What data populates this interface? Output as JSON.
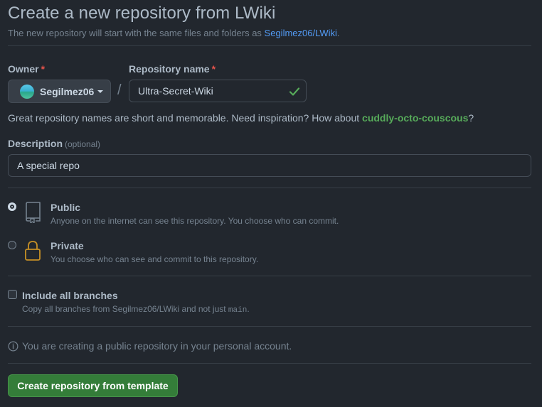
{
  "header": {
    "title": "Create a new repository from LWiki",
    "subtitle_prefix": "The new repository will start with the same files and folders as ",
    "template_link": "Segilmez06/LWiki",
    "subtitle_suffix": "."
  },
  "owner": {
    "label": "Owner",
    "required_mark": "*",
    "selected": "Segilmez06"
  },
  "repo_name": {
    "label": "Repository name",
    "required_mark": "*",
    "separator": "/",
    "value": "Ultra-Secret-Wiki",
    "valid_icon": "check-icon"
  },
  "name_hint": {
    "prefix": "Great repository names are short and memorable. Need inspiration? How about ",
    "suggestion": "cuddly-octo-couscous",
    "suffix": "?"
  },
  "description": {
    "label": "Description",
    "optional": "(optional)",
    "value": "A special repo"
  },
  "visibility": {
    "selected": "Public",
    "options": [
      {
        "title": "Public",
        "desc": "Anyone on the internet can see this repository. You choose who can commit.",
        "icon": "repo-book-icon",
        "checked": true
      },
      {
        "title": "Private",
        "desc": "You choose who can see and commit to this repository.",
        "icon": "lock-icon",
        "checked": false
      }
    ]
  },
  "branches": {
    "label": "Include all branches",
    "desc_prefix": "Copy all branches from Segilmez06/LWiki and not just ",
    "desc_code": "main",
    "desc_suffix": ".",
    "checked": false
  },
  "info": {
    "icon": "info-icon",
    "text": "You are creating a public repository in your personal account."
  },
  "submit": {
    "label": "Create repository from template"
  },
  "colors": {
    "background": "#22272e",
    "accent_link": "#539bf5",
    "success": "#57ab5a",
    "button_green": "#347d39",
    "lock_yellow": "#c69026",
    "required_red": "#e5534b"
  }
}
